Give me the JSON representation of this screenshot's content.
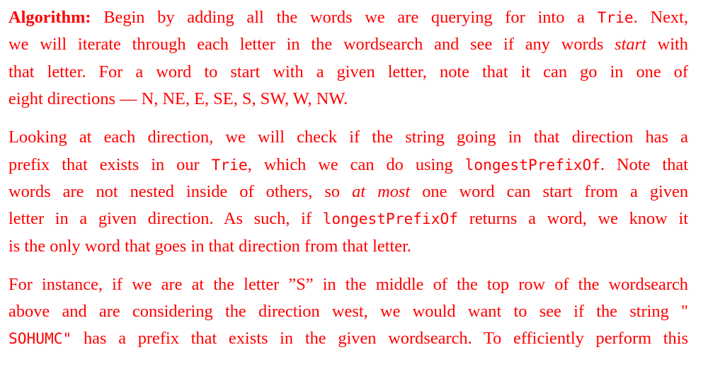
{
  "doc": {
    "p1": {
      "label": "Algorithm:",
      "l1a": " Begin by adding all the words we are querying for into a ",
      "l1_code": "Trie",
      "l1b": ". Next,",
      "l2a": "we will iterate through each letter in the wordsearch and see if any words ",
      "l2_em": "start",
      "l2b": " with",
      "l3": "that letter. For a word to start with a given letter, note that it can go in one of",
      "l4": "eight directions — N, NE, E, SE, S, SW, W, NW."
    },
    "p2": {
      "l1": "Looking at each direction, we will check if the string going in that direction has a",
      "l2a": "prefix that exists in our ",
      "l2_code": "Trie",
      "l2b": ", which we can do using ",
      "l2_code2": "longestPrefixOf",
      "l2c": ". Note that",
      "l3a": "words are not nested inside of others, so ",
      "l3_em": "at most",
      "l3b": " one word can start from a given",
      "l4a": "letter in a given direction. As such, if ",
      "l4_code": "longestPrefixOf",
      "l4b": " returns a word, we know it",
      "l5": "is the only word that goes in that direction from that letter."
    },
    "p3": {
      "l1": "For instance, if we are at the letter ”S” in the middle of the top row of the wordsearch",
      "l2": "above and are considering the direction west, we would want to see if the string \"",
      "l3_code": "SOHUMC\"",
      "l3b": " has a prefix that exists in the given wordsearch. To efficiently perform this"
    }
  }
}
